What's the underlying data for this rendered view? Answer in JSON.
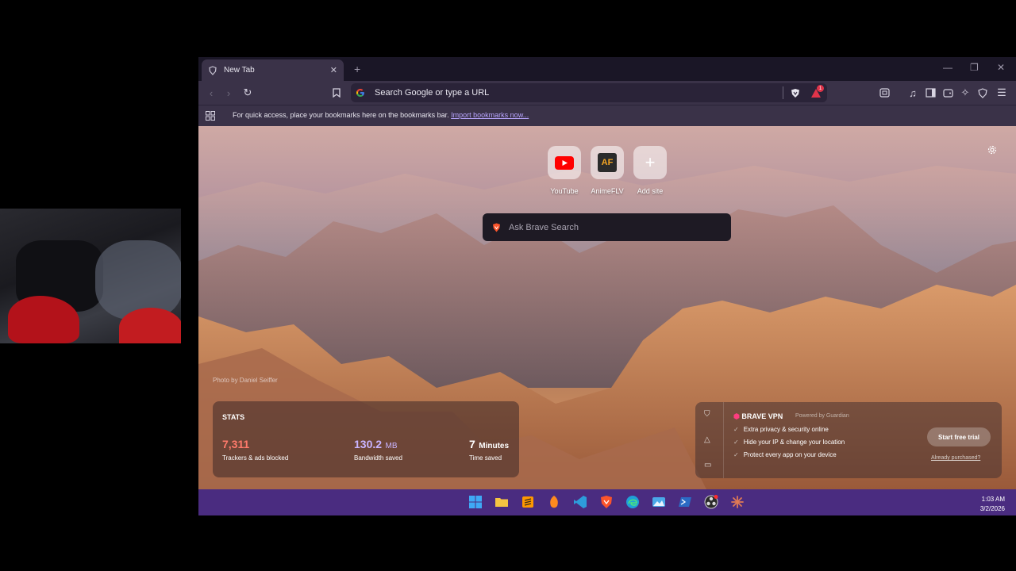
{
  "tab": {
    "title": "New Tab"
  },
  "omnibox": {
    "placeholder": "Search Google or type a URL",
    "alert_count": "1"
  },
  "bookmarks_bar": {
    "message": "For quick access, place your bookmarks here on the bookmarks bar.",
    "import_link": "Import bookmarks now..."
  },
  "top_sites": [
    {
      "label": "YouTube"
    },
    {
      "label": "AnimeFLV",
      "logo_text": "AF"
    },
    {
      "label": "Add site"
    }
  ],
  "search": {
    "placeholder": "Ask Brave Search"
  },
  "photo_credit": "Photo by Daniel Seiffer",
  "stats": {
    "heading": "STATS",
    "trackers_value": "7,311",
    "trackers_caption": "Trackers & ads blocked",
    "bandwidth_value": "130.2",
    "bandwidth_unit": "MB",
    "bandwidth_caption": "Bandwidth saved",
    "time_value": "7",
    "time_unit": "Minutes",
    "time_caption": "Time saved"
  },
  "vpn": {
    "title": "BRAVE VPN",
    "powered_by": "Powered by Guardian",
    "features": [
      "Extra privacy & security online",
      "Hide your IP & change your location",
      "Protect every app on your device"
    ],
    "cta": "Start free trial",
    "already": "Already purchased?"
  },
  "clock": {
    "time": "1:03 AM",
    "date": "3/2/2026"
  },
  "colors": {
    "taskbar": "#4a2c80",
    "toolbar": "#3a3248",
    "trackers": "#ff7a6b",
    "bandwidth": "#c9b4ff",
    "time": "#ffffff"
  }
}
